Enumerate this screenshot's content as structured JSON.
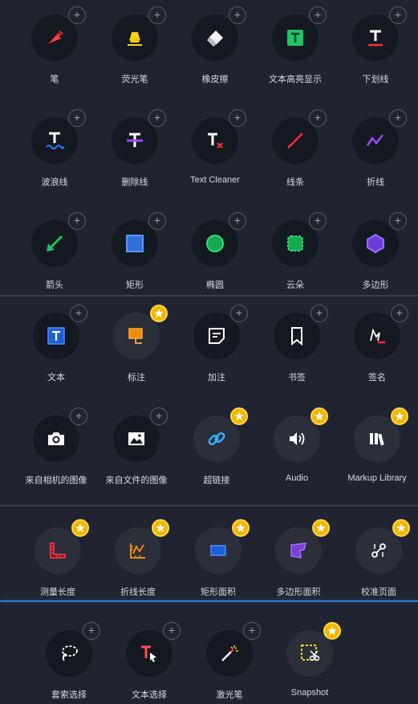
{
  "tools": {
    "pen": "笔",
    "highlighter": "荧光笔",
    "eraser": "橡皮擦",
    "text_highlight": "文本高亮显示",
    "underline": "下划线",
    "squiggly": "波浪线",
    "strikeout": "删除线",
    "text_cleaner": "Text Cleaner",
    "line": "线条",
    "polyline": "折线",
    "arrow": "箭头",
    "rectangle": "矩形",
    "ellipse": "椭圆",
    "cloud": "云朵",
    "polygon": "多边形",
    "text": "文本",
    "callout": "标注",
    "note": "加注",
    "bookmark": "书签",
    "signature": "签名",
    "camera_image": "来自相机的图像",
    "file_image": "来自文件的图像",
    "hyperlink": "超链接",
    "audio": "Audio",
    "markup_library": "Markup Library",
    "measure_length": "测量长度",
    "polyline_length": "折线长度",
    "rect_area": "矩形面积",
    "polygon_area": "多边形面积",
    "calibrate": "校准页面",
    "lasso": "套索选择",
    "text_select": "文本选择",
    "laser": "激光笔",
    "snapshot": "Snapshot"
  },
  "colors": {
    "background": "#1f2430",
    "circle": "#141821",
    "premium_star": "#f2b705",
    "accent_blue": "#3c79c8"
  }
}
